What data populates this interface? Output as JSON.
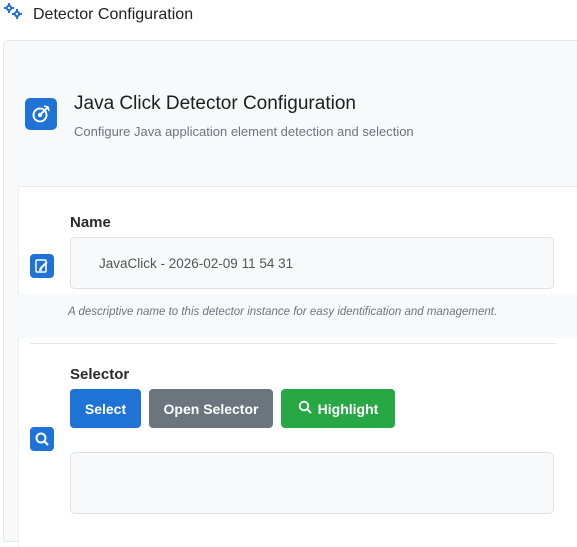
{
  "topbar": {
    "title": "Detector Configuration",
    "icon": "gears-icon"
  },
  "header": {
    "title": "Java Click Detector Configuration",
    "subtitle": "Configure Java application element detection and selection",
    "icon": "target-icon"
  },
  "name_section": {
    "label": "Name",
    "value": "JavaClick - 2026-02-09 11 54 31",
    "help": "A descriptive name to this detector instance for easy identification and management.",
    "icon": "edit-icon"
  },
  "selector_section": {
    "label": "Selector",
    "select_label": "Select",
    "open_label": "Open Selector",
    "highlight_label": "Highlight",
    "value": "",
    "icon": "search-icon"
  },
  "colors": {
    "primary": "#1f73d6",
    "secondary": "#6c757d",
    "success": "#28a745",
    "panel": "#f8f9fa"
  }
}
